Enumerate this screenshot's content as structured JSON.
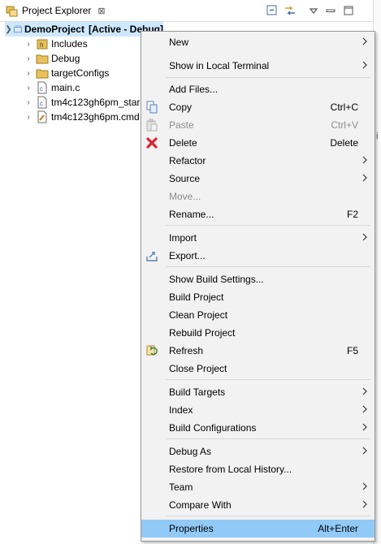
{
  "view": {
    "title": "Project Explorer",
    "close_glyph": "⊠",
    "right_edge_char": "i"
  },
  "toolbar": {
    "icons": [
      "collapse-all-icon",
      "link-with-editor-icon",
      "view-menu-icon",
      "minimize-icon",
      "maximize-icon"
    ]
  },
  "tree": {
    "project": {
      "name": "DemoProject",
      "status": "[Active - Debug]",
      "icon": "ccs-project-icon"
    },
    "items": [
      {
        "label": "Includes",
        "icon": "includes-folder-icon",
        "expandable": true
      },
      {
        "label": "Debug",
        "icon": "folder-icon",
        "expandable": true
      },
      {
        "label": "targetConfigs",
        "icon": "folder-icon",
        "expandable": true
      },
      {
        "label": "main.c",
        "icon": "c-file-icon",
        "expandable": true
      },
      {
        "label": "tm4c123gh6pm_star",
        "icon": "c-file-icon",
        "expandable": true
      },
      {
        "label": "tm4c123gh6pm.cmd",
        "icon": "cmd-file-icon",
        "expandable": true
      }
    ]
  },
  "menu": {
    "groups": [
      [
        {
          "label": "New",
          "submenu": true
        },
        {
          "label": "Show in Local Terminal",
          "submenu": true
        }
      ],
      [
        {
          "label": "Add Files..."
        },
        {
          "label": "Copy",
          "shortcut": "Ctrl+C",
          "icon": "copy-icon"
        },
        {
          "label": "Paste",
          "shortcut": "Ctrl+V",
          "icon": "paste-icon",
          "disabled": true
        },
        {
          "label": "Delete",
          "shortcut": "Delete",
          "icon": "delete-icon"
        },
        {
          "label": "Refactor",
          "submenu": true
        },
        {
          "label": "Source",
          "submenu": true
        },
        {
          "label": "Move...",
          "disabled": true
        },
        {
          "label": "Rename...",
          "shortcut": "F2"
        }
      ],
      [
        {
          "label": "Import",
          "submenu": true
        },
        {
          "label": "Export...",
          "icon": "export-icon"
        }
      ],
      [
        {
          "label": "Show Build Settings..."
        },
        {
          "label": "Build Project"
        },
        {
          "label": "Clean Project"
        },
        {
          "label": "Rebuild Project"
        },
        {
          "label": "Refresh",
          "shortcut": "F5",
          "icon": "refresh-icon"
        },
        {
          "label": "Close Project"
        }
      ],
      [
        {
          "label": "Build Targets",
          "submenu": true
        },
        {
          "label": "Index",
          "submenu": true
        },
        {
          "label": "Build Configurations",
          "submenu": true
        }
      ],
      [
        {
          "label": "Debug As",
          "submenu": true
        },
        {
          "label": "Restore from Local History..."
        },
        {
          "label": "Team",
          "submenu": true
        },
        {
          "label": "Compare With",
          "submenu": true
        }
      ],
      [
        {
          "label": "Properties",
          "shortcut": "Alt+Enter",
          "highlighted": true
        }
      ]
    ]
  },
  "colors": {
    "menu_bg": "#f2f2f2",
    "menu_highlight": "#91c9f7",
    "tree_selection": "#cde8ff",
    "delete_red": "#d8262c",
    "folder_yellow": "#e8c15a"
  }
}
